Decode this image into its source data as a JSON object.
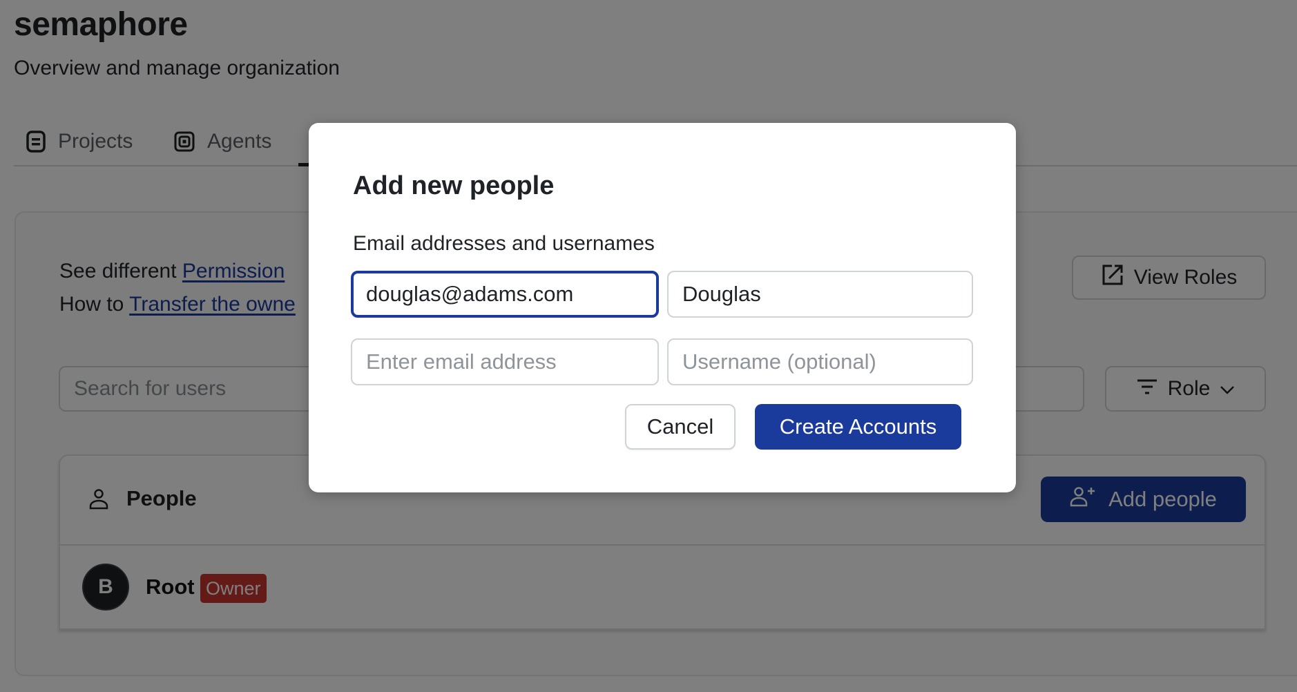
{
  "org": {
    "title": "semaphore",
    "subtitle": "Overview and manage organization"
  },
  "tabs": [
    {
      "label": "Projects",
      "icon": "projects-icon"
    },
    {
      "label": "Agents",
      "icon": "agents-icon"
    }
  ],
  "info": {
    "line1_prefix": "See different ",
    "line1_link": "Permission",
    "line2_prefix": "How to ",
    "line2_link": "Transfer the owne"
  },
  "view_roles": {
    "label": "View Roles",
    "icon": "external-link-icon"
  },
  "search": {
    "placeholder": "Search for users",
    "value": ""
  },
  "role_filter": {
    "label": "Role",
    "icon": "filter-icon"
  },
  "people": {
    "title": "People",
    "add_label": "Add people",
    "members": [
      {
        "initial": "B",
        "name": "Root",
        "badge": "Owner"
      }
    ]
  },
  "modal": {
    "title": "Add new people",
    "label": "Email addresses and usernames",
    "rows": [
      {
        "email": "douglas@adams.com",
        "username": "Douglas"
      },
      {
        "email": "",
        "username": ""
      }
    ],
    "email_placeholder": "Enter email address",
    "username_placeholder": "Username (optional)",
    "cancel_label": "Cancel",
    "create_label": "Create Accounts"
  },
  "colors": {
    "primary": "#1a3a9c",
    "owner_badge": "#c8342d",
    "overlay": "rgba(0,0,0,0.5)"
  }
}
